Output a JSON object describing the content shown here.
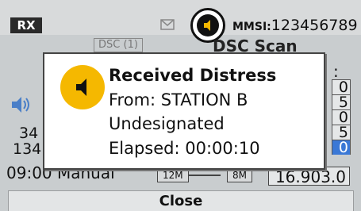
{
  "status_bar": {
    "rx_label": "RX",
    "mmsi_label": "MMSI:",
    "mmsi_value": "123456789"
  },
  "background": {
    "dsc_label": "DSC (1)",
    "title": "DSC Scan",
    "colon": ":",
    "left_values": [
      "34",
      "134"
    ],
    "right_column": [
      "0",
      "5",
      "0",
      "5",
      "0"
    ],
    "time_mode": "09:00 Manual",
    "range_left": "12M",
    "range_right": "8M",
    "frequency": "16.903.0"
  },
  "dialog": {
    "title": "Received Distress",
    "from": "From: STATION B",
    "category": "Undesignated",
    "elapsed": "Elapsed: 00:00:10",
    "icon": "speaker-alert-icon"
  },
  "softkey": {
    "close_label": "Close"
  },
  "colors": {
    "alert_yellow": "#f5b800",
    "selection_blue": "#3a78d6",
    "background_gray": "#c9cdcf"
  }
}
